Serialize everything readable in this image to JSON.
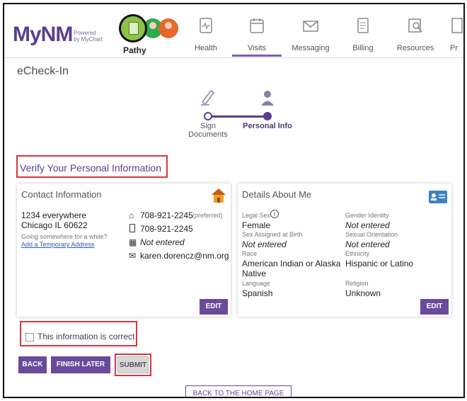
{
  "header": {
    "logo_text": "MyNM",
    "logo_powered": "Powered\nby MyChart",
    "active_user": "Pathy",
    "nav": [
      {
        "label": "Health",
        "icon": "health-icon"
      },
      {
        "label": "Visits",
        "icon": "calendar-icon",
        "active": true
      },
      {
        "label": "Messaging",
        "icon": "envelope-icon"
      },
      {
        "label": "Billing",
        "icon": "bill-icon"
      },
      {
        "label": "Resources",
        "icon": "resources-icon"
      },
      {
        "label": "Pr",
        "icon": "profile-icon"
      }
    ]
  },
  "page": {
    "title": "eCheck-In",
    "steps": [
      {
        "label": "Sign\nDocuments",
        "icon": "pen-icon"
      },
      {
        "label": "Personal Info",
        "icon": "person-icon"
      }
    ],
    "verify_title": "Verify Your Personal Information"
  },
  "contact": {
    "heading": "Contact Information",
    "address_line1": "1234 everywhere",
    "address_line2": "Chicago IL 60622",
    "going_somewhere": "Going somewhere for a while?",
    "temp_address_link": "Add a Temporary Address",
    "home_phone": "708-921-2245",
    "preferred": "(preferred)",
    "mobile_phone": "708-921-2245",
    "work_phone": "Not entered",
    "email": "karen.dorencz@nm.org",
    "edit_label": "EDIT"
  },
  "details": {
    "heading": "Details About Me",
    "legal_sex_label": "Legal Sex",
    "legal_sex": "Female",
    "gender_identity_label": "Gender Identity",
    "gender_identity": "Not entered",
    "sex_assigned_label": "Sex Assigned at Birth",
    "sex_assigned": "Not entered",
    "sexual_orientation_label": "Sexual Orientation",
    "sexual_orientation": "Not entered",
    "race_label": "Race",
    "race": "American Indian or Alaska Native",
    "ethnicity_label": "Ethnicity",
    "ethnicity": "Hispanic or Latino",
    "language_label": "Language",
    "language": "Spanish",
    "religion_label": "Religion",
    "religion": "Unknown",
    "edit_label": "EDIT"
  },
  "confirm": {
    "checkbox_label": "This information is correct"
  },
  "actions": {
    "back": "BACK",
    "finish_later": "FINISH LATER",
    "submit": "SUBMIT",
    "home": "BACK TO THE HOME PAGE"
  },
  "colors": {
    "brand_purple": "#5b3f8e",
    "button_purple": "#6a4a9b",
    "highlight_red": "#d9363e"
  }
}
